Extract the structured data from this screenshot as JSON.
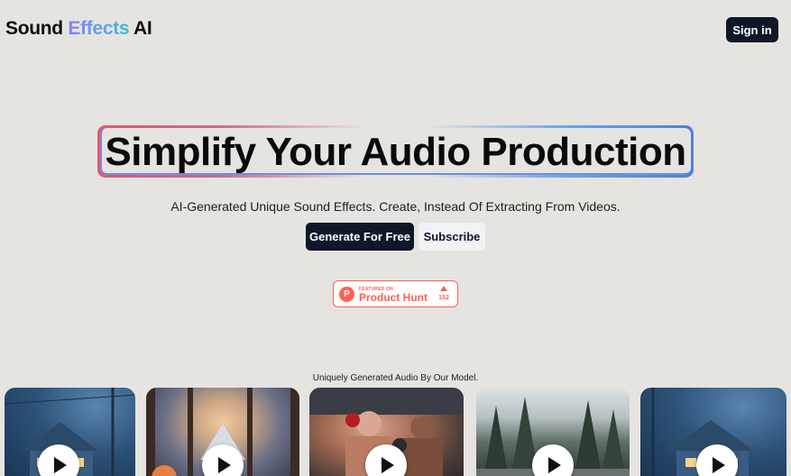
{
  "header": {
    "logo_part1": "Sound ",
    "logo_accent": "Effects",
    "logo_part2": " AI",
    "signin_label": "Sign in"
  },
  "hero": {
    "title": "Simplify Your Audio Production",
    "subtitle": "AI-Generated Unique Sound Effects. Create, Instead Of Extracting From Videos.",
    "primary_cta": "Generate For Free",
    "secondary_cta": "Subscribe"
  },
  "product_hunt": {
    "featured_label": "FEATURED ON",
    "name": "Product Hunt",
    "logo_letter": "P",
    "upvotes": "152",
    "brand_color": "#ff6154"
  },
  "gallery": {
    "caption": "Uniquely Generated Audio By Our Model.",
    "items": [
      {
        "scene": "night-house",
        "icon": "play-icon"
      },
      {
        "scene": "cabin",
        "icon": "play-icon"
      },
      {
        "scene": "fight",
        "icon": "play-icon"
      },
      {
        "scene": "forest",
        "icon": "play-icon"
      },
      {
        "scene": "night-house",
        "icon": "play-icon"
      }
    ]
  },
  "colors": {
    "background": "#e6e4e0",
    "primary_button": "#0f1729",
    "accent_gradient_start": "#8b7cf6",
    "accent_gradient_end": "#3bbad9"
  }
}
